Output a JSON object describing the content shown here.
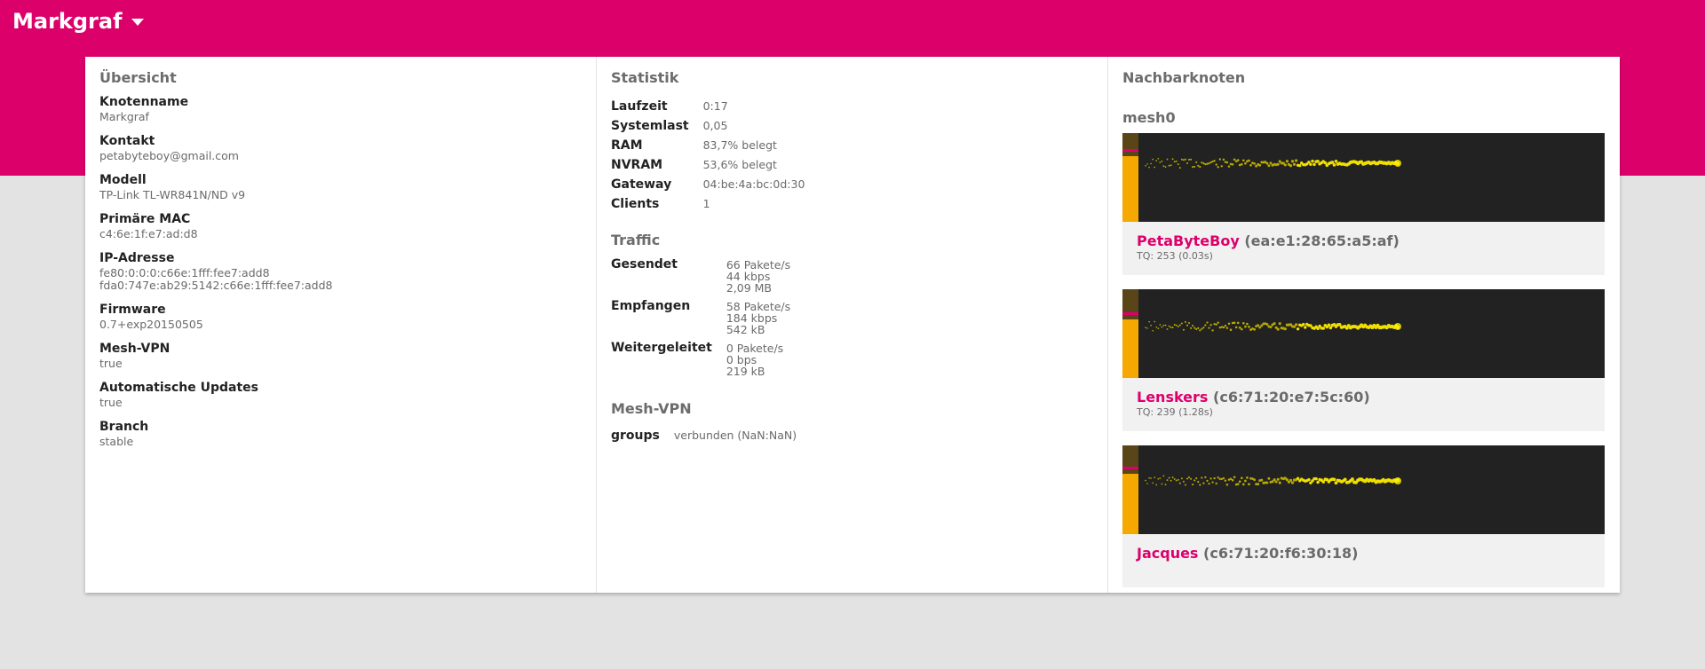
{
  "header": {
    "node_name": "Markgraf",
    "colors": {
      "brand": "#dc006b",
      "background": "#e3e3e3"
    }
  },
  "overview": {
    "title": "Übersicht",
    "items": [
      {
        "label": "Knotenname",
        "value": "Markgraf"
      },
      {
        "label": "Kontakt",
        "value": "petabyteboy@gmail.com"
      },
      {
        "label": "Modell",
        "value": "TP-Link TL-WR841N/ND v9"
      },
      {
        "label": "Primäre MAC",
        "value": "c4:6e:1f:e7:ad:d8"
      },
      {
        "label": "IP-Adresse",
        "value": "fe80:0:0:0:c66e:1fff:fee7:add8",
        "value2": "fda0:747e:ab29:5142:c66e:1fff:fee7:add8"
      },
      {
        "label": "Firmware",
        "value": "0.7+exp20150505"
      },
      {
        "label": "Mesh-VPN",
        "value": "true"
      },
      {
        "label": "Automatische Updates",
        "value": "true"
      },
      {
        "label": "Branch",
        "value": "stable"
      }
    ]
  },
  "statistics": {
    "title": "Statistik",
    "rows": [
      {
        "label": "Laufzeit",
        "value": "0:17"
      },
      {
        "label": "Systemlast",
        "value": "0,05"
      },
      {
        "label": "RAM",
        "value": "83,7% belegt"
      },
      {
        "label": "NVRAM",
        "value": "53,6% belegt"
      },
      {
        "label": "Gateway",
        "value": "04:be:4a:bc:0d:30"
      },
      {
        "label": "Clients",
        "value": "1"
      }
    ],
    "traffic_title": "Traffic",
    "traffic": [
      {
        "label": "Gesendet",
        "lines": [
          "66 Pakete/s",
          "44 kbps",
          "2,09 MB"
        ]
      },
      {
        "label": "Empfangen",
        "lines": [
          "58 Pakete/s",
          "184 kbps",
          "542 kB"
        ]
      },
      {
        "label": "Weitergeleitet",
        "lines": [
          "0 Pakete/s",
          "0 bps",
          "219 kB"
        ]
      }
    ],
    "meshvpn_title": "Mesh-VPN",
    "meshvpn": {
      "label": "groups",
      "value": "verbunden (NaN:NaN)"
    }
  },
  "neighbours": {
    "title": "Nachbarknoten",
    "interface": "mesh0",
    "items": [
      {
        "name": "PetaByteBoy",
        "mac": "(ea:e1:28:65:a5:af)",
        "tq": "TQ: 253 (0.03s)",
        "signal_level": 0.74
      },
      {
        "name": "Lenskers",
        "mac": "(c6:71:20:e7:5c:60)",
        "tq": "TQ: 239 (1.28s)",
        "signal_level": 0.66
      },
      {
        "name": "Jacques",
        "mac": "(c6:71:20:f6:30:18)",
        "tq": "",
        "signal_level": 0.68
      }
    ]
  }
}
